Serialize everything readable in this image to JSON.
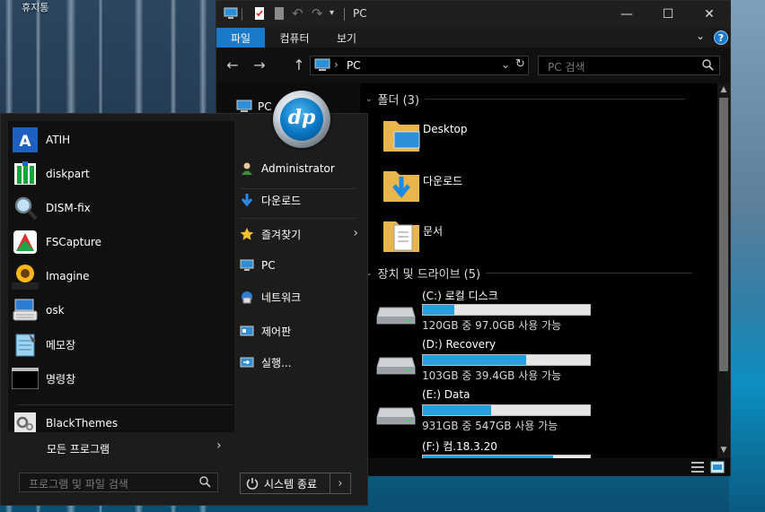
{
  "desktop": {
    "label": "휴지통"
  },
  "explorer": {
    "title": "PC",
    "window_controls": {
      "minimize": "—",
      "maximize": "☐",
      "close": "✕"
    },
    "ribbon": {
      "tabs": [
        "파일",
        "컴퓨터",
        "보기"
      ],
      "help": "?",
      "collapse": "⌄"
    },
    "nav": {
      "back": "←",
      "forward": "→",
      "up": "↑"
    },
    "address": {
      "separator": "›",
      "location": "PC",
      "dropdown": "⌄",
      "refresh": "↻"
    },
    "search": {
      "placeholder": "PC 검색"
    },
    "navpane": {
      "item": "PC"
    },
    "folders_header": "폴더 (3)",
    "folders": [
      {
        "name": "Desktop",
        "icon": "desktop-folder-icon"
      },
      {
        "name": "다운로드",
        "icon": "downloads-folder-icon"
      },
      {
        "name": "문서",
        "icon": "documents-folder-icon"
      }
    ],
    "drives_header": "장치 및 드라이브 (5)",
    "drives": [
      {
        "name": "(C:) 로컬 디스크",
        "free": "120GB 중 97.0GB 사용 가능",
        "used_fraction": 0.19
      },
      {
        "name": "(D:) Recovery",
        "free": "103GB 중 39.4GB 사용 가능",
        "used_fraction": 0.62
      },
      {
        "name": "(E:) Data",
        "free": "931GB 중 547GB 사용 가능",
        "used_fraction": 0.41
      },
      {
        "name": "(F:) 컴.18.3.20",
        "free": "",
        "used_fraction": 0.78
      }
    ]
  },
  "startmenu": {
    "programs": [
      {
        "label": "ATIH",
        "icon": "acronis-icon"
      },
      {
        "label": "diskpart",
        "icon": "diskpart-icon"
      },
      {
        "label": "DISM-fix",
        "icon": "magnifier-icon"
      },
      {
        "label": "FSCapture",
        "icon": "fscapture-icon"
      },
      {
        "label": "Imagine",
        "icon": "imagine-icon",
        "icon_text": "Imagine"
      },
      {
        "label": "osk",
        "icon": "keyboard-icon"
      },
      {
        "label": "메모장",
        "icon": "notepad-icon"
      },
      {
        "label": "명령창",
        "icon": "cmd-icon",
        "icon_text": "C:\\_"
      },
      {
        "label": "BlackThemes",
        "icon": "gears-icon"
      }
    ],
    "all_programs": "모든 프로그램",
    "all_programs_arrow": "›",
    "search_placeholder": "프로그램 및 파일 검색",
    "avatar_text": "dp",
    "right_items": [
      {
        "label": "Administrator",
        "icon": "user-icon"
      },
      {
        "label": "다운로드",
        "icon": "download-arrow-icon"
      },
      {
        "label": "즐겨찾기",
        "icon": "star-icon",
        "arrow": "›"
      },
      {
        "label": "PC",
        "icon": "pc-icon"
      },
      {
        "label": "네트워크",
        "icon": "network-icon"
      },
      {
        "label": "제어판",
        "icon": "control-panel-icon"
      },
      {
        "label": "실행...",
        "icon": "run-icon"
      }
    ],
    "shutdown": {
      "label": "시스템 종료",
      "arrow": "›"
    }
  },
  "colors": {
    "accent": "#1979ca",
    "drive_bar": "#26a0da",
    "menu_bg": "#1c1c1c"
  }
}
